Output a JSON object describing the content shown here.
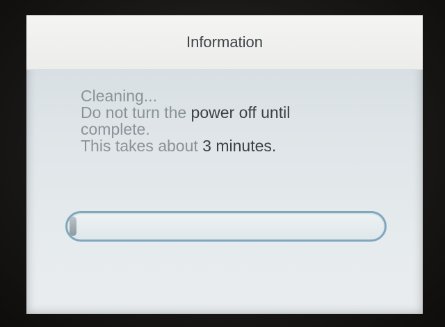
{
  "dialog": {
    "title": "Information",
    "message": {
      "line1": "Cleaning...",
      "line2_light": "Do not turn the ",
      "line2_dark": "power off until",
      "line3": "complete.",
      "line4_light": "This takes about ",
      "line4_dark": "3 minutes."
    },
    "progress": {
      "fraction": 0.02
    }
  },
  "colors": {
    "title_bar": "#f4f4f2",
    "screen_background": "#dfe5e8",
    "progress_border": "#7fa8bf",
    "text_dark": "#3a3f43",
    "text_light": "#8a9298"
  }
}
